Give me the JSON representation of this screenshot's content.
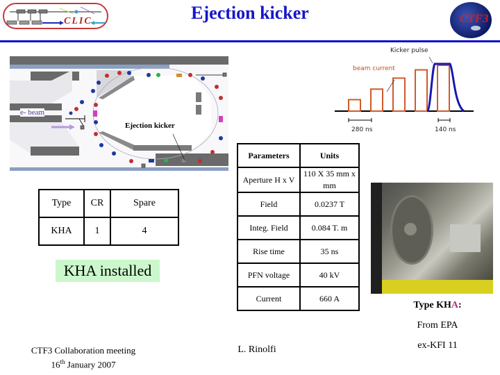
{
  "header": {
    "title": "Ejection kicker",
    "left_logo_text": "CLIC",
    "right_logo_text": "CTF3",
    "accent_color": "#1010c8"
  },
  "ring_diagram": {
    "beam_label": "e- beam",
    "kicker_label": "Ejection kicker"
  },
  "pulse_diagram": {
    "kicker_pulse_label": "Kicker pulse",
    "beam_current_label": "beam current",
    "spacing_label": "280 ns",
    "width_label": "140 ns",
    "beam_bars_relative_height": [
      0.25,
      0.48,
      0.72,
      0.9,
      1.0
    ],
    "beam_color": "#d05a2a",
    "pulse_color": "#1818b0"
  },
  "parameters_table": {
    "headers": [
      "Parameters",
      "Units"
    ],
    "rows": [
      [
        "Aperture H x V",
        "110 X 35 mm x mm"
      ],
      [
        "Field",
        "0.0237 T"
      ],
      [
        "Integ. Field",
        "0.084 T. m"
      ],
      [
        "Rise time",
        "35 ns"
      ],
      [
        "PFN voltage",
        "40 kV"
      ],
      [
        "Current",
        "660 A"
      ]
    ]
  },
  "type_table": {
    "headers": [
      "Type",
      "CR",
      "Spare"
    ],
    "rows": [
      [
        "KHA",
        "1",
        "4"
      ]
    ]
  },
  "status": {
    "installed_label": "KHA installed",
    "installed_bg": "#ccf7cc"
  },
  "photo_caption": {
    "line1_prefix": "Type KH",
    "line1_highlight": "A",
    "line1_suffix": ":",
    "line2": "From EPA",
    "line3": "ex-KFI 11"
  },
  "footer": {
    "meeting": "CTF3 Collaboration meeting",
    "date_day": "16",
    "date_sup": "th",
    "date_rest": " January 2007",
    "author": "L. Rinolfi"
  }
}
